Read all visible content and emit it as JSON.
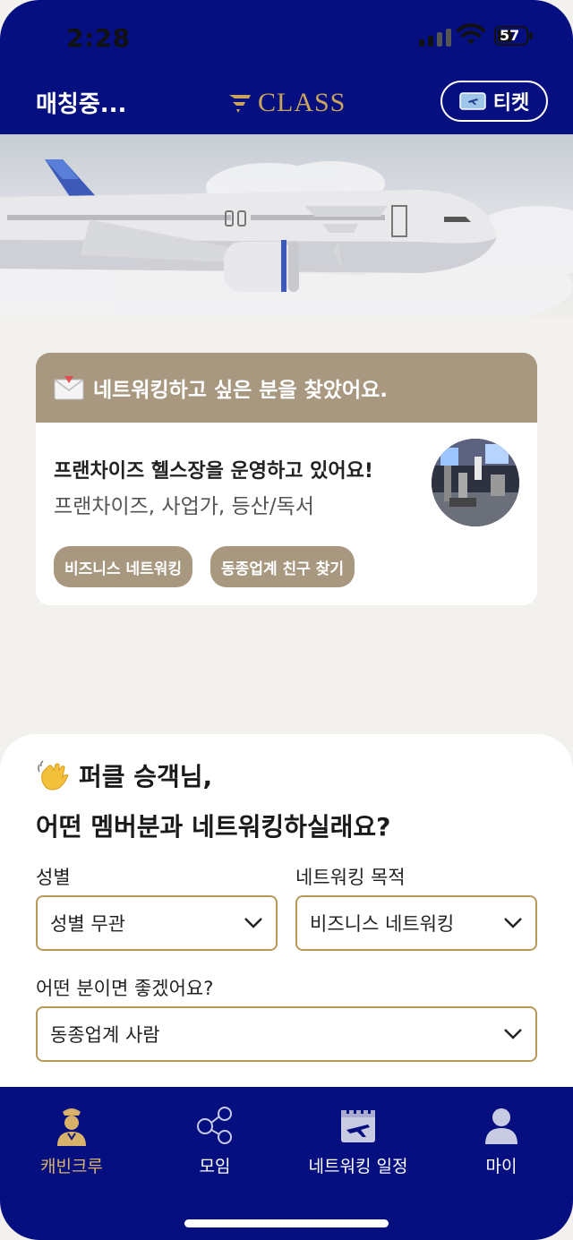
{
  "status_bar": {
    "time": "2:28",
    "battery": "57"
  },
  "header": {
    "status": "매칭중...",
    "logo_text": "CLASS",
    "ticket_label": "티켓"
  },
  "match_card": {
    "heading": "네트워킹하고 싶은 분을 찾았어요.",
    "title": "프랜차이즈 헬스장을 운영하고 있어요!",
    "tags": "프랜차이즈, 사업가, 등산/독서",
    "chips": [
      "비즈니스 네트워킹",
      "동종업계 친구 찾기"
    ]
  },
  "preferences": {
    "greeting_line1": "퍼클 승객님,",
    "greeting_line2": "어떤 멤버분과 네트워킹하실래요?",
    "gender_label": "성별",
    "gender_value": "성별 무관",
    "purpose_label": "네트워킹 목적",
    "purpose_value": "비즈니스 네트워킹",
    "person_label": "어떤 분이면 좋겠어요?",
    "person_value": "동종업계 사람"
  },
  "tab_bar": {
    "items": [
      {
        "label": "캐빈크루",
        "icon": "crew-icon",
        "active": true
      },
      {
        "label": "모임",
        "icon": "network-icon",
        "active": false
      },
      {
        "label": "네트워킹 일정",
        "icon": "calendar-plane-icon",
        "active": false
      },
      {
        "label": "마이",
        "icon": "profile-icon",
        "active": false
      }
    ]
  },
  "colors": {
    "brand_navy": "#050f80",
    "gold": "#c9a45c",
    "taupe": "#a89880"
  }
}
